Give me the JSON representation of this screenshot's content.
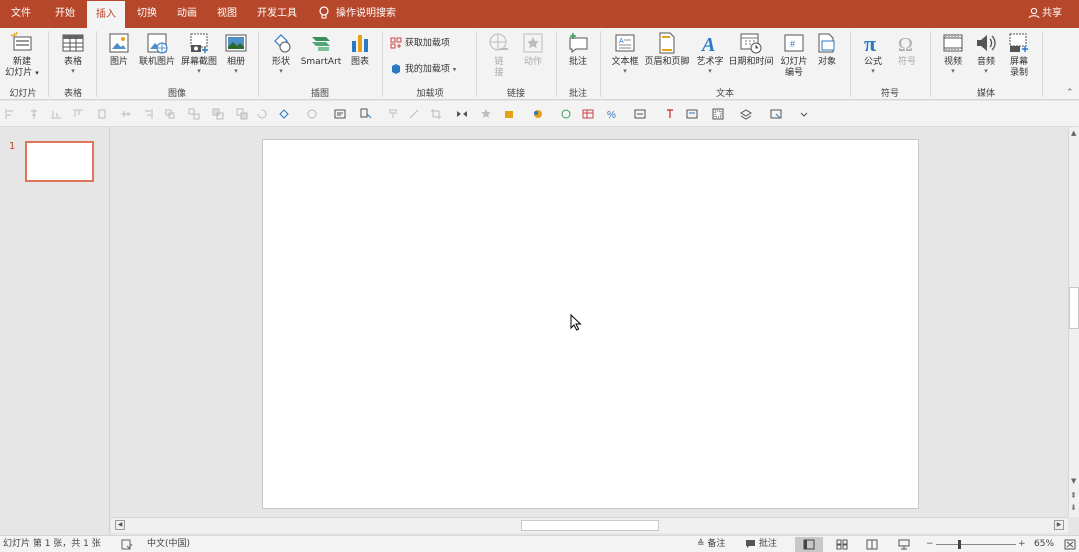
{
  "tabs": [
    "文件",
    "开始",
    "插入",
    "切换",
    "动画",
    "视图",
    "开发工具"
  ],
  "active_tab": "插入",
  "tell_me": "操作说明搜索",
  "share": "共享",
  "ribbon": {
    "new_slide": "新建",
    "new_slide_2": "幻灯片",
    "table": "表格",
    "picture": "图片",
    "online_picture": "联机图片",
    "screenshot": "屏幕截图",
    "album": "相册",
    "shapes": "形状",
    "smartart": "SmartArt",
    "chart": "图表",
    "get_addins": "获取加载项",
    "my_addins": "我的加载项",
    "link_1": "链",
    "link_2": "接",
    "action": "动作",
    "comment": "批注",
    "textbox": "文本框",
    "header_footer": "页眉和页脚",
    "wordart": "艺术字",
    "datetime": "日期和时间",
    "slide_num_1": "幻灯片",
    "slide_num_2": "编号",
    "object": "对象",
    "equation": "公式",
    "symbol": "符号",
    "video": "视频",
    "audio": "音频",
    "screen_rec_1": "屏幕",
    "screen_rec_2": "录制",
    "groups": {
      "slides": "幻灯片",
      "tables": "表格",
      "images": "图像",
      "illustrations": "插图",
      "addins": "加载项",
      "links": "链接",
      "comments": "批注",
      "text": "文本",
      "symbols": "符号",
      "media": "媒体"
    }
  },
  "thumbnail_number": "1",
  "status": {
    "slide_info": "幻灯片 第 1 张，共 1 张",
    "language": "中文(中国)",
    "notes": "备注",
    "comments": "批注",
    "zoom": "65%"
  },
  "colors": {
    "accent": "#b7472a",
    "thumb_border": "#e0745a"
  },
  "zoom_level": 0.65
}
